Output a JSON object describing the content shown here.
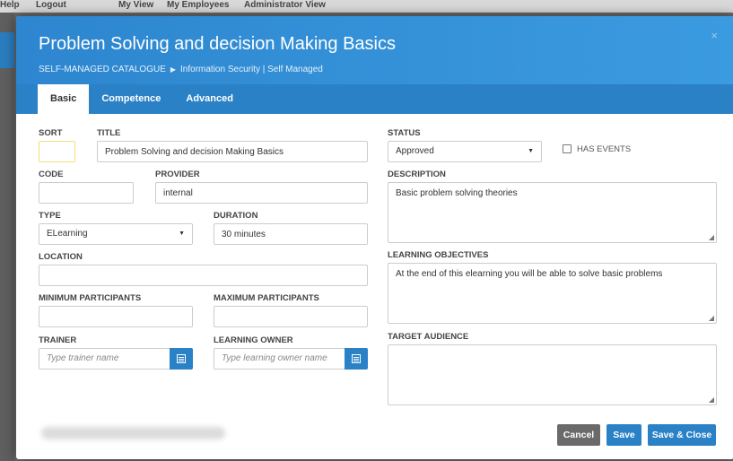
{
  "background": {
    "nav": [
      "Help",
      "Logout",
      "My View",
      "My Employees",
      "Administrator View"
    ]
  },
  "modal": {
    "title": "Problem Solving and decision Making Basics",
    "breadcrumb": [
      "SELF-MANAGED CATALOGUE",
      "Information Security | Self Managed"
    ],
    "close": "×"
  },
  "tabs": [
    {
      "label": "Basic",
      "active": true
    },
    {
      "label": "Competence",
      "active": false
    },
    {
      "label": "Advanced",
      "active": false
    }
  ],
  "form": {
    "sort": {
      "label": "SORT",
      "value": ""
    },
    "title": {
      "label": "TITLE",
      "value": "Problem Solving and decision Making Basics"
    },
    "code": {
      "label": "CODE",
      "value": ""
    },
    "provider": {
      "label": "PROVIDER",
      "value": "internal"
    },
    "type": {
      "label": "TYPE",
      "value": "ELearning"
    },
    "duration": {
      "label": "DURATION",
      "value": "30 minutes"
    },
    "location": {
      "label": "LOCATION",
      "value": ""
    },
    "min_participants": {
      "label": "MINIMUM PARTICIPANTS",
      "value": ""
    },
    "max_participants": {
      "label": "MAXIMUM PARTICIPANTS",
      "value": ""
    },
    "trainer": {
      "label": "TRAINER",
      "placeholder": "Type trainer name"
    },
    "learning_owner": {
      "label": "LEARNING OWNER",
      "placeholder": "Type learning owner name"
    },
    "status": {
      "label": "STATUS",
      "value": "Approved"
    },
    "has_events": {
      "label": "HAS EVENTS",
      "checked": false
    },
    "description": {
      "label": "DESCRIPTION",
      "value": "Basic problem solving theories"
    },
    "learning_objectives": {
      "label": "LEARNING OBJECTIVES",
      "value": "At the end of this elearning you will be able to solve basic problems"
    },
    "target_audience": {
      "label": "TARGET AUDIENCE",
      "value": ""
    }
  },
  "actions": {
    "cancel": "Cancel",
    "save": "Save",
    "save_close": "Save & Close"
  },
  "colors": {
    "header": "#2d86cf",
    "tabbar": "#2a81c6",
    "primary_button": "#2a81c6",
    "cancel_button": "#6a6a6a"
  }
}
